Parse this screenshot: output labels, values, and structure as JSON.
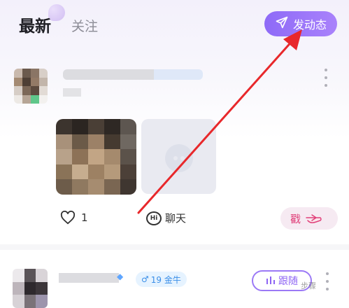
{
  "header": {
    "tab_latest": "最新",
    "tab_following": "关注",
    "post_button": "发动态",
    "post_icon": "paper-plane-icon"
  },
  "post1": {
    "like_count": "1",
    "chat_label": "聊天",
    "chat_icon_text": "Hi",
    "poke_label": "戳"
  },
  "post2": {
    "zodiac_symbol": "♂",
    "zodiac_label": "19 金牛",
    "follow_label": "跟随"
  },
  "watermark": "步骤",
  "colors": {
    "accent": "#9b79f6",
    "annotation_arrow": "#e8282b",
    "poke_text": "#e0407a"
  }
}
